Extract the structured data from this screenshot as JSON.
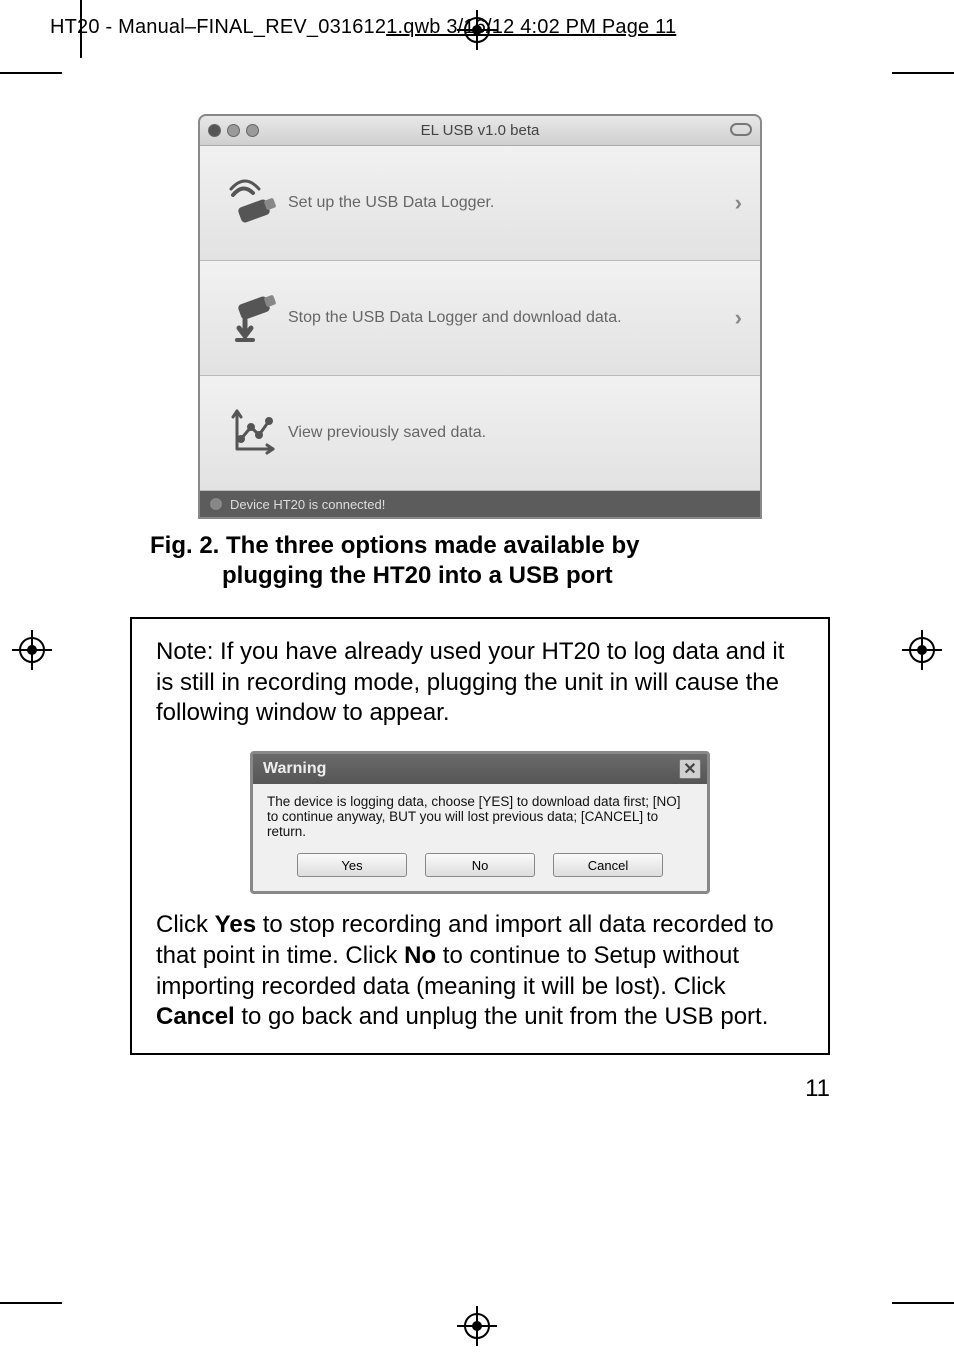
{
  "header": "HT20 - Manual–FINAL_REV_031612",
  "header_tail": "1.qwb  3/16/12  4:02 PM  Page 11",
  "mac_window": {
    "title": "EL USB v1.0 beta",
    "rows": [
      {
        "label": "Set up the USB Data Logger.",
        "chevron": "›"
      },
      {
        "label": "Stop the USB Data Logger and download data.",
        "chevron": "›"
      },
      {
        "label": "View previously saved data.",
        "chevron": ""
      }
    ],
    "status": "Device HT20 is connected!"
  },
  "caption_line1": "Fig. 2. The three options made available by",
  "caption_line2": "plugging the HT20 into a USB port",
  "note": "Note: If you have already used your HT20 to log data and it is still in recording mode, plugging the unit in will cause the following window to appear.",
  "dialog": {
    "title": "Warning",
    "body": "The device is logging data, choose [YES] to download data first; [NO] to continue anyway, BUT you will lost previous data; [CANCEL] to return.",
    "buttons": {
      "yes": "Yes",
      "no": "No",
      "cancel": "Cancel"
    }
  },
  "click1": "Click ",
  "click_yes": "Yes",
  "click2": " to stop recording and import all data recorded to that point in time. Click ",
  "click_no": "No",
  "click3": " to continue to Setup without importing recorded data (meaning it will be lost). Click ",
  "click_cancel": "Cancel",
  "click4": " to go back and unplug the unit from the USB port.",
  "page_number": "11"
}
